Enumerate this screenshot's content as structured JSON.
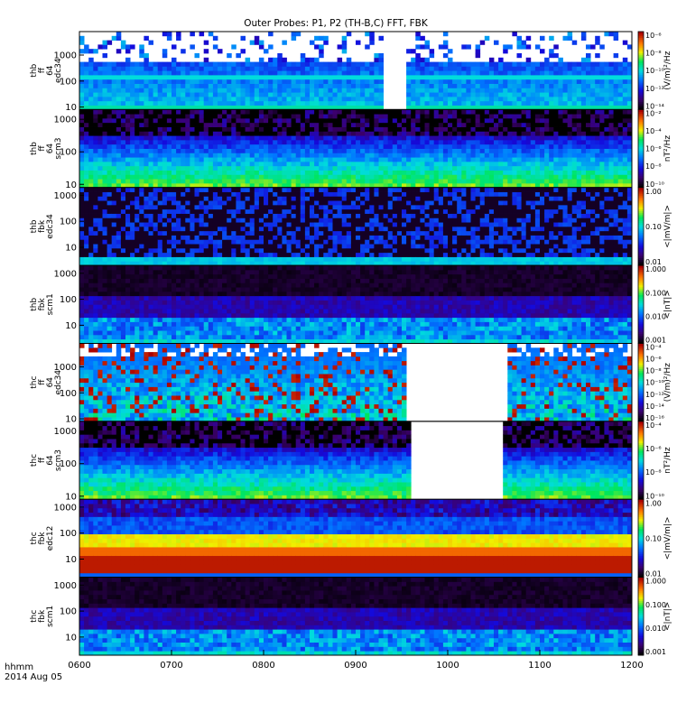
{
  "title": "Outer Probes: P1, P2 (TH-B,C) FFT, FBK",
  "date_label": {
    "line1": "hhmm",
    "line2": "2014 Aug 05"
  },
  "chart_data": {
    "type": "heatmap",
    "title": "Outer Probes: P1, P2 (TH-B,C) FFT, FBK",
    "x_axis": {
      "label": "hhmm",
      "range_hours": [
        6,
        12
      ],
      "ticks": [
        "0600",
        "0700",
        "0800",
        "0900",
        "1000",
        "1100",
        "1200"
      ]
    },
    "panels": [
      {
        "label_lines": [
          "thb",
          "ff",
          "64",
          "edc34"
        ],
        "yticks": [
          "10",
          "100",
          "1000"
        ],
        "ylim": [
          8,
          8000
        ],
        "log_y": true,
        "colorbar": {
          "scale": "log",
          "range": [
            1e-14,
            1e-06
          ],
          "ticks": [
            "10⁻⁶",
            "10⁻⁸",
            "10⁻¹⁰",
            "10⁻¹²",
            "10⁻¹⁴"
          ],
          "unit": "(V/m)²/Hz"
        },
        "style": "efi",
        "gap_hours": [
          9.3,
          9.55
        ]
      },
      {
        "label_lines": [
          "thb",
          "ff",
          "64",
          "scm3"
        ],
        "yticks": [
          "10",
          "100",
          "1000"
        ],
        "ylim": [
          8,
          2000
        ],
        "log_y": true,
        "colorbar": {
          "scale": "log",
          "range": [
            1e-10,
            0.01
          ],
          "ticks": [
            "10⁻²",
            "10⁻⁴",
            "10⁻⁶",
            "10⁻⁸",
            "10⁻¹⁰"
          ],
          "unit": "nT²/Hz"
        },
        "style": "scm"
      },
      {
        "label_lines": [
          "thb",
          "fbk",
          "edc34"
        ],
        "yticks": [
          "10",
          "100",
          "1000"
        ],
        "ylim": [
          2,
          2000
        ],
        "log_y": true,
        "colorbar": {
          "scale": "log",
          "range": [
            0.005,
            1.5
          ],
          "ticks": [
            "1.00",
            "0.10",
            "0.01"
          ],
          "unit": "<|mV/m|>"
        },
        "style": "fbk_e_quiet"
      },
      {
        "label_lines": [
          "thb",
          "fbk",
          "scm1"
        ],
        "yticks": [
          "10",
          "100",
          "1000"
        ],
        "ylim": [
          2,
          2000
        ],
        "log_y": true,
        "colorbar": {
          "scale": "log",
          "range": [
            0.0008,
            1.2
          ],
          "ticks": [
            "1.000",
            "0.100",
            "0.010",
            "0.001"
          ],
          "unit": "<|nT|>"
        },
        "style": "fbk_b"
      },
      {
        "label_lines": [
          "thc",
          "ff",
          "64",
          "edc34"
        ],
        "yticks": [
          "10",
          "100",
          "1000"
        ],
        "ylim": [
          8,
          8000
        ],
        "log_y": true,
        "colorbar": {
          "scale": "log",
          "range": [
            1e-16,
            0.0001
          ],
          "ticks": [
            "10⁻⁴",
            "10⁻⁶",
            "10⁻⁸",
            "10⁻¹⁰",
            "10⁻¹²",
            "10⁻¹⁴",
            "10⁻¹⁶"
          ],
          "unit": "(V/m)²/Hz"
        },
        "style": "efi_burst",
        "gap_hours": [
          9.55,
          10.67
        ]
      },
      {
        "label_lines": [
          "thc",
          "ff",
          "64",
          "scm3"
        ],
        "yticks": [
          "10",
          "100",
          "1000"
        ],
        "ylim": [
          8,
          2000
        ],
        "log_y": true,
        "colorbar": {
          "scale": "log",
          "range": [
            1e-10,
            0.001
          ],
          "ticks": [
            "10⁻⁴",
            "10⁻⁶",
            "10⁻⁸",
            "10⁻¹⁰"
          ],
          "unit": "nT²/Hz"
        },
        "style": "scm",
        "gap_hours": [
          9.6,
          10.6
        ]
      },
      {
        "label_lines": [
          "thc",
          "fbk",
          "edc12"
        ],
        "yticks": [
          "10",
          "100",
          "1000"
        ],
        "ylim": [
          2,
          2000
        ],
        "log_y": true,
        "colorbar": {
          "scale": "log",
          "range": [
            0.005,
            1.5
          ],
          "ticks": [
            "1.00",
            "0.10",
            "0.01"
          ],
          "unit": "<|mV/m|>"
        },
        "style": "fbk_e_strong"
      },
      {
        "label_lines": [
          "thc",
          "fbk",
          "scm1"
        ],
        "yticks": [
          "10",
          "100",
          "1000"
        ],
        "ylim": [
          2,
          2000
        ],
        "log_y": true,
        "colorbar": {
          "scale": "log",
          "range": [
            0.0008,
            1.2
          ],
          "ticks": [
            "1.000",
            "0.100",
            "0.010",
            "0.001"
          ],
          "unit": "<|nT|>"
        },
        "style": "fbk_b"
      }
    ]
  }
}
